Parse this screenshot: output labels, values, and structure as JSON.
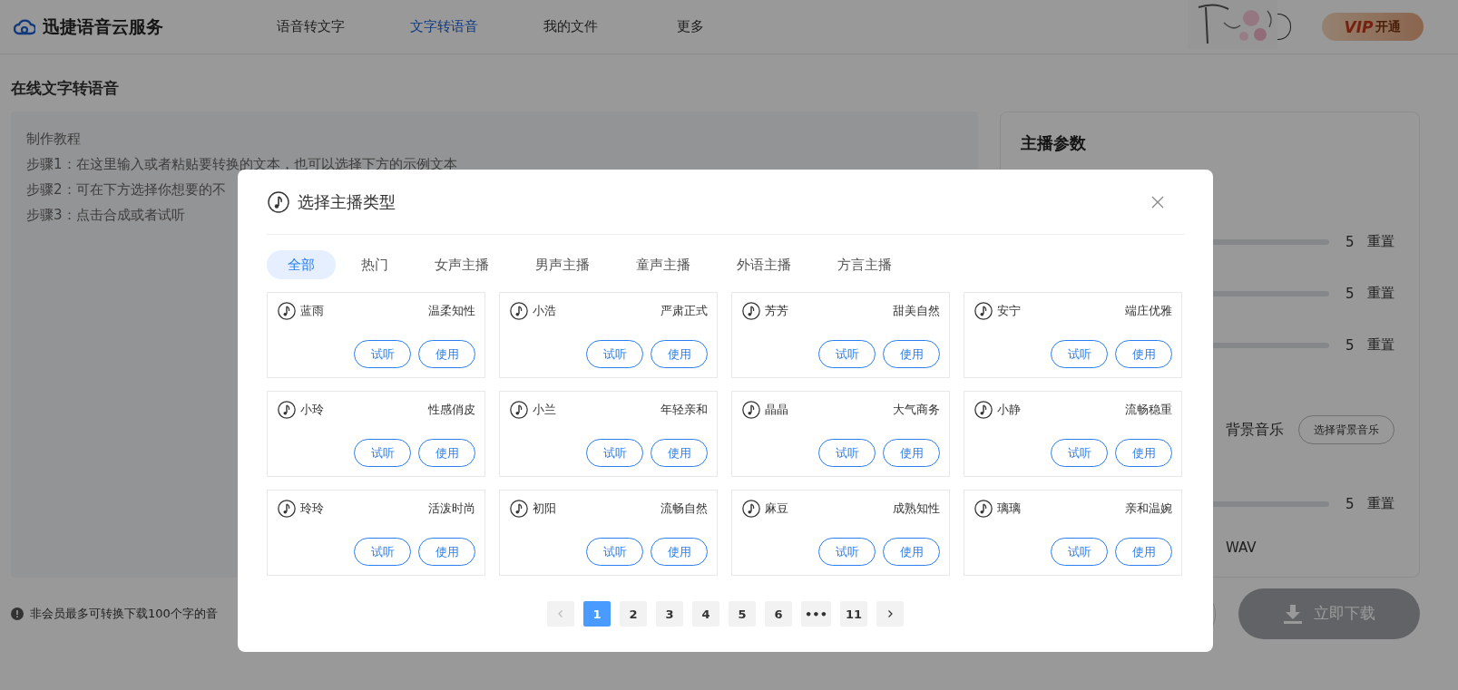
{
  "header": {
    "logo": "迅捷语音云服务",
    "nav": [
      {
        "label": "语音转文字",
        "selected": false
      },
      {
        "label": "文字转语音",
        "selected": true
      },
      {
        "label": "我的文件",
        "selected": false
      },
      {
        "label": "更多",
        "selected": false
      }
    ],
    "vip": {
      "badge": "VIP",
      "label": "开通"
    }
  },
  "page_title": "在线文字转语音",
  "editor": {
    "lines": [
      "制作教程",
      "步骤1：在这里输入或者粘贴要转换的文本，也可以选择下方的示例文本",
      "步骤2：可在下方选择你想要的不",
      "步骤3：点击合成或者试听"
    ]
  },
  "settings": {
    "title": "主播参数",
    "rows": [
      {
        "kind": "slider",
        "reading": "5",
        "reset": "重置"
      },
      {
        "kind": "slider",
        "reading": "5",
        "reset": "重置"
      },
      {
        "kind": "slider",
        "reading": "5",
        "reset": "重置"
      },
      {
        "kind": "music",
        "label": "背景音乐",
        "button": "选择背景音乐"
      },
      {
        "kind": "slider",
        "reading": "5",
        "reset": "重置"
      },
      {
        "kind": "format",
        "label": "WAV"
      }
    ]
  },
  "notice": "非会员最多可转换下载100个字的音",
  "download_button": {
    "label": "立即下载",
    "disabled": true
  },
  "dialog": {
    "title": "选择主播类型",
    "tabs": [
      {
        "label": "全部",
        "selected": true
      },
      {
        "label": "热门",
        "selected": false
      },
      {
        "label": "女声主播",
        "selected": false
      },
      {
        "label": "男声主播",
        "selected": false
      },
      {
        "label": "童声主播",
        "selected": false
      },
      {
        "label": "外语主播",
        "selected": false
      },
      {
        "label": "方言主播",
        "selected": false
      }
    ],
    "voices": [
      {
        "name": "蓝雨",
        "style": "温柔知性",
        "preview": "试听",
        "use": "使用"
      },
      {
        "name": "小浩",
        "style": "严肃正式",
        "preview": "试听",
        "use": "使用"
      },
      {
        "name": "芳芳",
        "style": "甜美自然",
        "preview": "试听",
        "use": "使用"
      },
      {
        "name": "安宁",
        "style": "端庄优雅",
        "preview": "试听",
        "use": "使用"
      },
      {
        "name": "小玲",
        "style": "性感俏皮",
        "preview": "试听",
        "use": "使用"
      },
      {
        "name": "小兰",
        "style": "年轻亲和",
        "preview": "试听",
        "use": "使用"
      },
      {
        "name": "晶晶",
        "style": "大气商务",
        "preview": "试听",
        "use": "使用"
      },
      {
        "name": "小静",
        "style": "流畅稳重",
        "preview": "试听",
        "use": "使用"
      },
      {
        "name": "玲玲",
        "style": "活泼时尚",
        "preview": "试听",
        "use": "使用"
      },
      {
        "name": "初阳",
        "style": "流畅自然",
        "preview": "试听",
        "use": "使用"
      },
      {
        "name": "麻豆",
        "style": "成熟知性",
        "preview": "试听",
        "use": "使用"
      },
      {
        "name": "璃璃",
        "style": "亲和温婉",
        "preview": "试听",
        "use": "使用"
      }
    ],
    "pagination": {
      "prev_disabled": true,
      "next_disabled": false,
      "pages": [
        {
          "label": "1",
          "selected": true
        },
        {
          "label": "2",
          "selected": false
        },
        {
          "label": "3",
          "selected": false
        },
        {
          "label": "4",
          "selected": false
        },
        {
          "label": "5",
          "selected": false
        },
        {
          "label": "6",
          "selected": false
        },
        {
          "label": "•••",
          "selected": false
        },
        {
          "label": "11",
          "selected": false
        }
      ]
    }
  }
}
